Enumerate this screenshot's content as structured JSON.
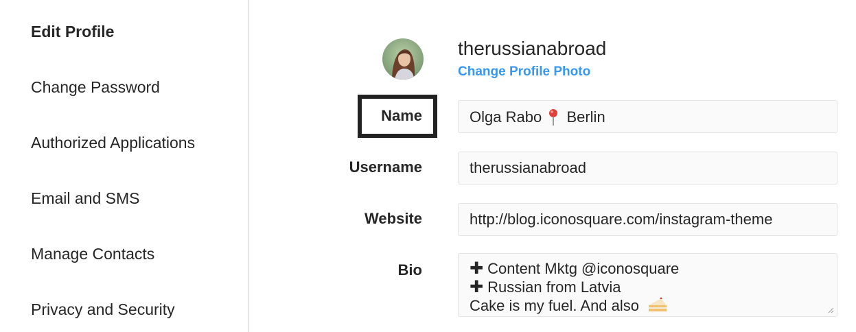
{
  "sidebar": {
    "items": [
      {
        "label": "Edit Profile",
        "active": true
      },
      {
        "label": "Change Password",
        "active": false
      },
      {
        "label": "Authorized Applications",
        "active": false
      },
      {
        "label": "Email and SMS",
        "active": false
      },
      {
        "label": "Manage Contacts",
        "active": false
      },
      {
        "label": "Privacy and Security",
        "active": false
      }
    ]
  },
  "profile": {
    "username": "therussianabroad",
    "change_photo_label": "Change Profile Photo",
    "avatar_icon": "profile-photo"
  },
  "form": {
    "name_label": "Name",
    "name_value_first": "Olga Rabo",
    "name_pin_icon": "round-pushpin-icon",
    "name_value_second": "Berlin",
    "username_label": "Username",
    "username_value": "therussianabroad",
    "website_label": "Website",
    "website_value": "http://blog.iconosquare.com/instagram-theme",
    "bio_label": "Bio",
    "bio_lines": [
      {
        "prefix": "✚",
        "text": "Content Mktg @iconosquare"
      },
      {
        "prefix": "✚",
        "text": "Russian from Latvia"
      },
      {
        "prefix": "",
        "text": "Cake is my fuel. And also"
      }
    ],
    "bio_emoji_icon": "cake-slice-icon"
  },
  "colors": {
    "link": "#3897f0",
    "text": "#262626",
    "border": "#e3e3e3",
    "highlight_box": "#222222"
  }
}
